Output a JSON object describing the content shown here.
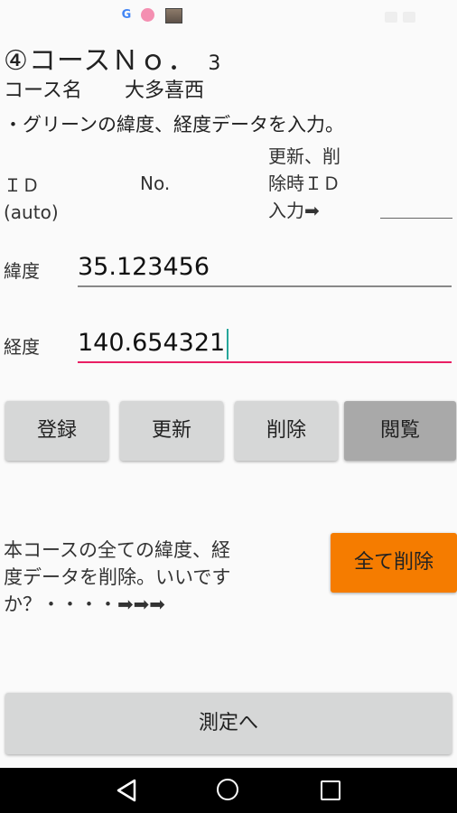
{
  "status_bar": {
    "icons": [
      "google-icon",
      "notification-circle-icon",
      "image-icon"
    ],
    "g_glyph": "G"
  },
  "header": {
    "title": "④コースＮｏ．",
    "course_number": "3",
    "course_name_label": "コース名",
    "course_name": "大多喜西"
  },
  "instruction": "・グリーンの緯度、経度データを入力。",
  "id_row": {
    "id_label_line1": "ＩＤ",
    "id_label_line2": "(auto)",
    "no_label": "No.",
    "update_label_line1": "更新、削",
    "update_label_line2": "除時ＩＤ",
    "update_label_line3": "入力➡",
    "update_input_value": ""
  },
  "fields": {
    "latitude_label": "緯度",
    "latitude_value": "35.123456",
    "longitude_label": "経度",
    "longitude_value": "140.654321"
  },
  "buttons": {
    "register": "登録",
    "update": "更新",
    "delete": "削除",
    "browse": "閲覧"
  },
  "delete_all": {
    "confirm_line1": "本コースの全ての緯度、経",
    "confirm_line2": "度データを削除。いいです",
    "confirm_line3": "か？・・・・➡➡➡",
    "button": "全て削除"
  },
  "measure_button": "測定へ",
  "colors": {
    "accent_pink": "#e91e63",
    "delete_all_orange": "#f57c00",
    "button_gray": "#d6d7d7",
    "browse_gray": "#a9a9a9"
  }
}
